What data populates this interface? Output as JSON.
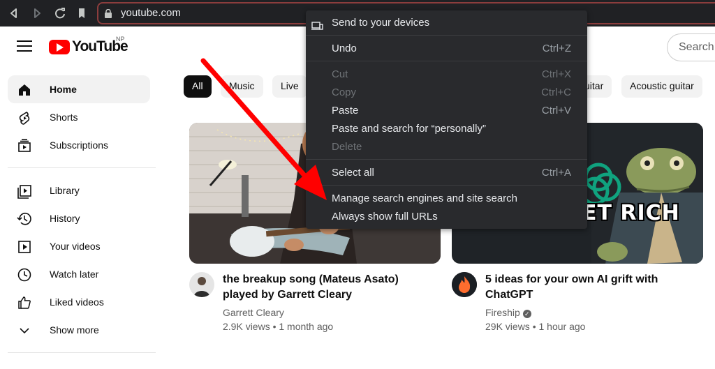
{
  "browser": {
    "url": "youtube.com",
    "nav": [
      "back-icon",
      "forward-icon",
      "reload-icon",
      "bookmark-icon"
    ]
  },
  "masthead": {
    "logo_text": "YouTube",
    "country_code": "NP",
    "search_placeholder": "Search"
  },
  "sidebar": {
    "items": [
      {
        "label": "Home",
        "icon": "home-icon",
        "active": true
      },
      {
        "label": "Shorts",
        "icon": "shorts-icon"
      },
      {
        "label": "Subscriptions",
        "icon": "subscriptions-icon"
      },
      {
        "label": "Library",
        "icon": "library-icon"
      },
      {
        "label": "History",
        "icon": "history-icon"
      },
      {
        "label": "Your videos",
        "icon": "your-videos-icon"
      },
      {
        "label": "Watch later",
        "icon": "watch-later-icon"
      },
      {
        "label": "Liked videos",
        "icon": "liked-videos-icon"
      },
      {
        "label": "Show more",
        "icon": "chevron-down-icon"
      }
    ]
  },
  "chips": [
    "All",
    "Music",
    "Live",
    "uitar",
    "Acoustic guitar"
  ],
  "videos": [
    {
      "title_line1": "the breakup song (Mateus Asato)",
      "title_line2": "played by Garrett Cleary",
      "channel": "Garrett Cleary",
      "meta": "2.9K views • 1 month ago"
    },
    {
      "title_line1": "5 ideas for your own AI grift with",
      "title_line2": "ChatGPT",
      "channel": "Fireship",
      "verified": true,
      "meta": "29K views • 1 hour ago",
      "thumb_text": "ET RICH"
    }
  ],
  "context_menu": {
    "items": [
      {
        "label": "Send to your devices",
        "shortcut": "",
        "icon": "devices-icon"
      },
      {
        "label": "Undo",
        "shortcut": "Ctrl+Z"
      },
      {
        "label": "Cut",
        "shortcut": "Ctrl+X",
        "disabled": true
      },
      {
        "label": "Copy",
        "shortcut": "Ctrl+C",
        "disabled": true
      },
      {
        "label": "Paste",
        "shortcut": "Ctrl+V"
      },
      {
        "label": "Paste and search for “personally”",
        "shortcut": ""
      },
      {
        "label": "Delete",
        "shortcut": "",
        "disabled": true
      },
      {
        "label": "Select all",
        "shortcut": "Ctrl+A"
      },
      {
        "label": "Manage search engines and site search",
        "shortcut": ""
      },
      {
        "label": "Always show full URLs",
        "shortcut": ""
      }
    ]
  },
  "colors": {
    "browser_bg": "#202124",
    "menu_bg": "#292a2d",
    "arrow": "#ff0000",
    "yt_red": "#ff0000"
  }
}
